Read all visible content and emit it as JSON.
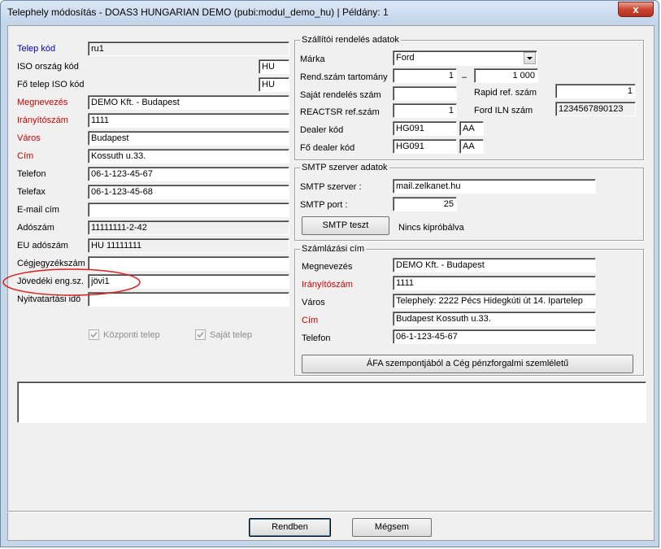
{
  "window": {
    "title": "Telephely módosítás - DOAS3 HUNGARIAN DEMO (pubi:modul_demo_hu) | Példány: 1",
    "close_glyph": "x"
  },
  "left": {
    "telep_kod": {
      "label": "Telep kód",
      "value": "ru1"
    },
    "iso_orszag_kod": {
      "label": "ISO ország kód",
      "value": "HU"
    },
    "fo_telep_iso_kod": {
      "label": "Fő telep ISO kód",
      "value": "HU"
    },
    "megnevezes": {
      "label": "Megnevezés",
      "value": "DEMO Kft. - Budapest"
    },
    "iranyitoszam": {
      "label": "Irányítószám",
      "value": "1111"
    },
    "varos": {
      "label": "Város",
      "value": "Budapest"
    },
    "cim": {
      "label": "Cím",
      "value": "Kossuth u.33."
    },
    "telefon": {
      "label": "Telefon",
      "value": "06-1-123-45-67"
    },
    "telefax": {
      "label": "Telefax",
      "value": "06-1-123-45-68"
    },
    "email": {
      "label": "E-mail cím",
      "value": ""
    },
    "adoszam": {
      "label": "Adószám",
      "value": "11111111-2-42"
    },
    "eu_adoszam": {
      "label": "EU adószám",
      "value": "HU 11111111"
    },
    "cegjegyzekszam": {
      "label": "Cégjegyzékszám",
      "value": ""
    },
    "jovedeki": {
      "label": "Jövedéki eng.sz.",
      "value": "jövi1"
    },
    "nyitvatartasi": {
      "label": "Nyitvatartási idő",
      "value": ""
    },
    "kozponti_telep": {
      "label": "Központi telep",
      "checked": true
    },
    "sajat_telep": {
      "label": "Saját telep",
      "checked": true
    }
  },
  "supplier": {
    "title": "Szállítói rendelés adatok",
    "marka": {
      "label": "Márka",
      "value": "Ford"
    },
    "rend_szam": {
      "label": "Rend.szám tartomány",
      "from": "1",
      "dash": "–",
      "to": "1 000"
    },
    "sajat_rendeles": {
      "label": "Saját rendelés szám",
      "value": ""
    },
    "rapid": {
      "label": "Rapid ref. szám",
      "value": "1"
    },
    "reactsr": {
      "label": "REACTSR ref.szám",
      "value": "1"
    },
    "ford_iln": {
      "label": "Ford ILN szám",
      "value": "1234567890123"
    },
    "dealer": {
      "label": "Dealer kód",
      "value": "HG091",
      "suffix": "AA"
    },
    "fo_dealer": {
      "label": "Fő dealer kód",
      "value": "HG091",
      "suffix": "AA"
    }
  },
  "smtp": {
    "title": "SMTP szerver adatok",
    "server": {
      "label": "SMTP szerver :",
      "value": "mail.zelkanet.hu"
    },
    "port": {
      "label": "SMTP port :",
      "value": "25"
    },
    "test_button": "SMTP teszt",
    "status": "Nincs kipróbálva"
  },
  "billing": {
    "title": "Számlázási cím",
    "megnevezes": {
      "label": "Megnevezés",
      "value": "DEMO Kft. - Budapest"
    },
    "iranyitoszam": {
      "label": "Irányítószám",
      "value": "1111"
    },
    "varos": {
      "label": "Város",
      "value": "Telephely: 2222 Pécs Hidegkúti út 14. Ipartelep"
    },
    "cim": {
      "label": "Cím",
      "value": "Budapest Kossuth u.33."
    },
    "telefon": {
      "label": "Telefon",
      "value": "06-1-123-45-67"
    },
    "afa_button": "ÁFA szempontjából a Cég pénzforgalmi szemléletű"
  },
  "footer": {
    "ok_button": "Rendben",
    "cancel_button": "Mégsem"
  },
  "colors": {
    "required_label": "#cc0000",
    "key_label": "#0000c8",
    "annotation_ellipse": "#e0201c"
  }
}
